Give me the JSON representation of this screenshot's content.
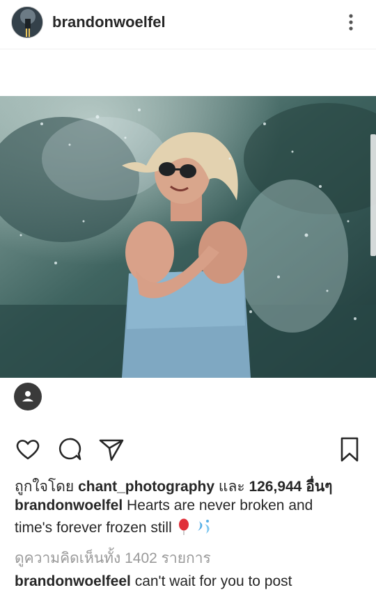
{
  "post": {
    "username": "brandonwoelfel",
    "liked_by_prefix": "ถูกใจโดย",
    "liked_by_user": "chant_photography",
    "liked_by_joiner": "และ",
    "likes_count": "126,944",
    "likes_suffix": "อื่นๆ",
    "caption_user": "brandonwoelfel",
    "caption_line1": "Hearts are never broken and",
    "caption_line2": "time's forever frozen still",
    "view_comments": "ดูความคิดเห็นทั้ง 1402 รายการ",
    "comment_user": "brandonwoelfeel",
    "comment_text": "can't wait for you to post"
  },
  "icons": {
    "more": "more-vertical-icon",
    "tag": "user-tag-icon",
    "like": "heart-icon",
    "comment": "comment-icon",
    "share": "send-icon",
    "save": "bookmark-icon"
  },
  "colors": {
    "text": "#262626",
    "muted": "#999999",
    "balloon": "#e0303a"
  }
}
